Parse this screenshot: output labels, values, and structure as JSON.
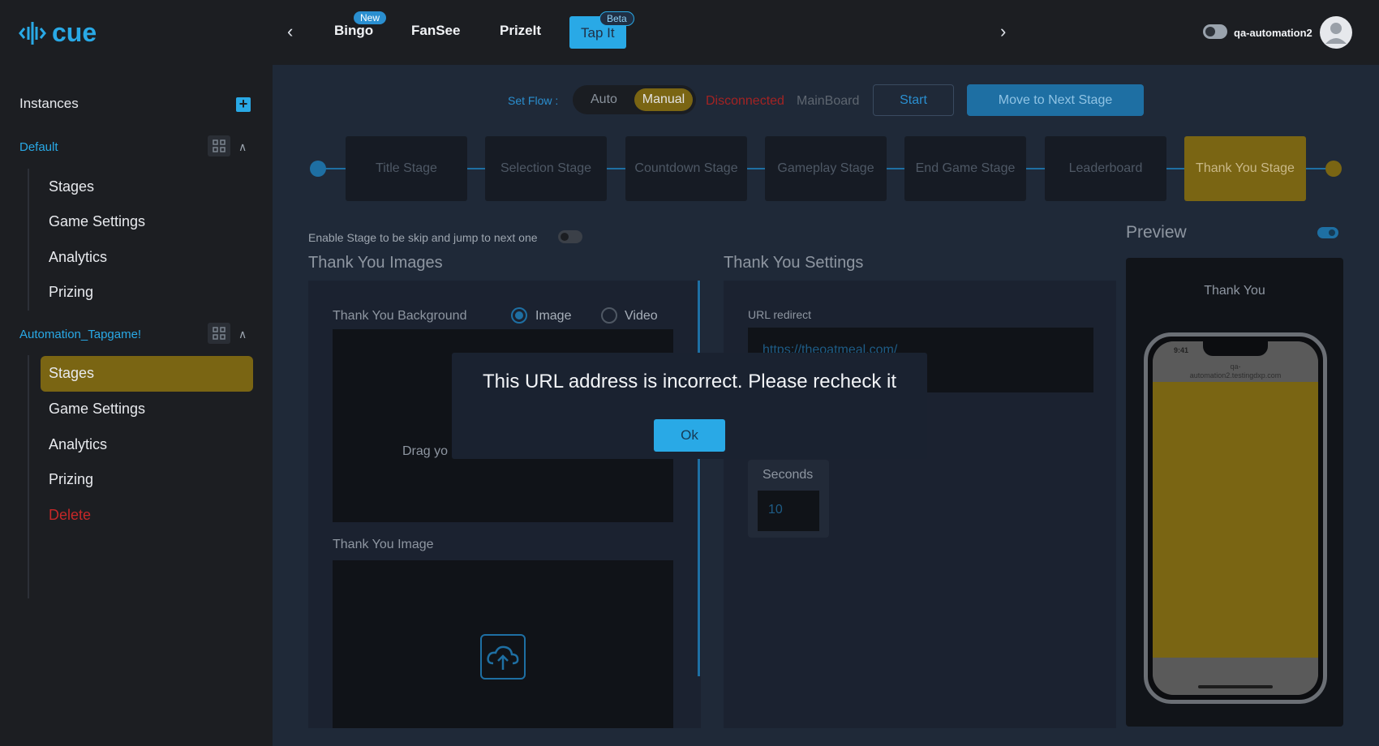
{
  "header": {
    "logo_text": "cue",
    "tabs": [
      {
        "label": "Bingo",
        "badge": "New"
      },
      {
        "label": "FanSee",
        "badge": ""
      },
      {
        "label": "PrizeIt",
        "badge": ""
      },
      {
        "label": "Tap It",
        "badge": "Beta",
        "active": true
      }
    ],
    "username": "qa-automation2"
  },
  "sidebar": {
    "title": "Instances",
    "groups": [
      {
        "name": "Default",
        "items": [
          "Stages",
          "Game Settings",
          "Analytics",
          "Prizing"
        ]
      },
      {
        "name": "Automation_Tapgame!",
        "items": [
          "Stages",
          "Game Settings",
          "Analytics",
          "Prizing",
          "Delete"
        ],
        "active_item": "Stages"
      }
    ]
  },
  "flow": {
    "label": "Set Flow :",
    "auto": "Auto",
    "manual": "Manual",
    "status_disconnected": "Disconnected",
    "status_board": "MainBoard",
    "start": "Start",
    "next_stage": "Move to Next Stage"
  },
  "stages": [
    "Title Stage",
    "Selection Stage",
    "Countdown Stage",
    "Gameplay Stage",
    "End Game Stage",
    "Leaderboard",
    "Thank You Stage"
  ],
  "active_stage": "Thank You Stage",
  "skip_label": "Enable Stage to be skip and jump to next one",
  "images_section": {
    "title": "Thank You Images",
    "background_label": "Thank You Background",
    "opt_image": "Image",
    "opt_video": "Video",
    "drag_text": "Drag yo",
    "image_label": "Thank You Image"
  },
  "settings_section": {
    "title": "Thank You Settings",
    "url_label": "URL redirect",
    "url_value": "https://theoatmeal.com/",
    "seconds_label": "Seconds",
    "seconds_value": "10"
  },
  "preview": {
    "title": "Preview",
    "caption": "Thank You",
    "phone_time": "9:41",
    "phone_url_line1": "qa-",
    "phone_url_line2": "automation2.testingdxp.com"
  },
  "modal": {
    "message": "This URL address is incorrect. Please recheck it",
    "ok": "Ok"
  },
  "colors": {
    "accent": "#29a9e6",
    "gold": "#7a6513",
    "danger": "#c62828"
  }
}
